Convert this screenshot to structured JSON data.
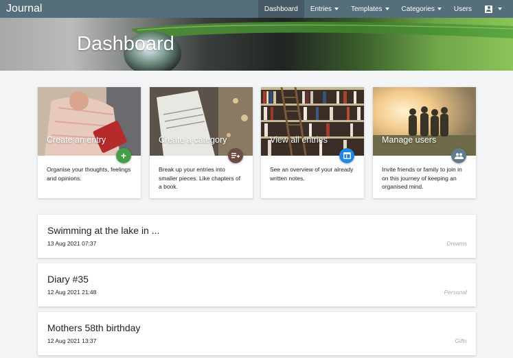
{
  "app": {
    "title": "Journal"
  },
  "nav": {
    "dashboard": "Dashboard",
    "entries": "Entries",
    "templates": "Templates",
    "categories": "Categories",
    "users": "Users"
  },
  "hero": {
    "title": "Dashboard"
  },
  "cards": [
    {
      "title": "Create an entry",
      "text": "Organise your thoughts, feelings and opinions.",
      "icon": "add-icon",
      "color": "#43a047"
    },
    {
      "title": "Create a category",
      "text": "Break up your entries into smaller pieces. Like chapters of a book.",
      "icon": "playlist-add-icon",
      "color": "#6d4c41"
    },
    {
      "title": "View all entries",
      "text": "See an overview of your already written notes.",
      "icon": "web-icon",
      "color": "#1e88e5"
    },
    {
      "title": "Manage users",
      "text": "Invite friends or family to join in on this journey of keeping an organised mind.",
      "icon": "people-icon",
      "color": "#607d8b"
    }
  ],
  "entries": [
    {
      "title": "Swimming at the lake in ...",
      "date": "13 Aug 2021 07:37",
      "category": "Dreams"
    },
    {
      "title": "Diary #35",
      "date": "12 Aug 2021 21:48",
      "category": "Personal"
    },
    {
      "title": "Mothers 58th birthday",
      "date": "12 Aug 2021 13:37",
      "category": "Gifts"
    }
  ],
  "colors": {
    "navbar": "#546e7a",
    "navbar_active": "#455a64",
    "background": "#f3f4f6"
  }
}
